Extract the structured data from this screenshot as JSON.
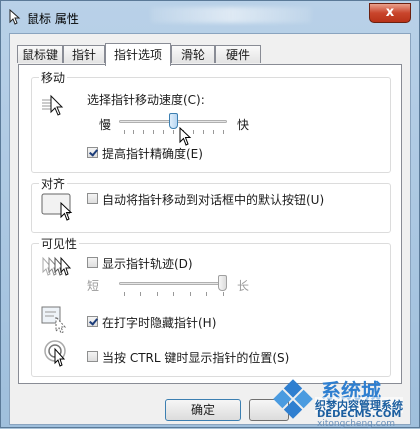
{
  "window": {
    "title": "鼠标 属性",
    "close_glyph": "x"
  },
  "tabs": [
    {
      "label": "鼠标键"
    },
    {
      "label": "指针"
    },
    {
      "label": "指针选项"
    },
    {
      "label": "滑轮"
    },
    {
      "label": "硬件"
    }
  ],
  "motion": {
    "group_title": "移动",
    "speed_label": "选择指针移动速度(C):",
    "slow_label": "慢",
    "fast_label": "快",
    "speed_value": 0.5,
    "precision_label": "提高指针精确度(E)",
    "precision_checked": true
  },
  "snap": {
    "group_title": "对齐",
    "snap_label": "自动将指针移动到对话框中的默认按钮(U)",
    "snap_checked": false
  },
  "visibility": {
    "group_title": "可见性",
    "trails_label": "显示指针轨迹(D)",
    "trails_checked": false,
    "short_label": "短",
    "long_label": "长",
    "trails_value": 1.0,
    "hide_label": "在打字时隐藏指针(H)",
    "hide_checked": true,
    "ctrl_label": "当按 CTRL 键时显示指针的位置(S)",
    "ctrl_checked": false
  },
  "buttons": {
    "ok_label": "确定"
  },
  "watermark": {
    "brand": "系统城",
    "line1": "织梦内容管理系统",
    "line2": "DEDECMS.COM",
    "line3": "xitongcheng.com"
  },
  "colors": {
    "accent": "#3c7fb1",
    "close": "#c9452c"
  }
}
